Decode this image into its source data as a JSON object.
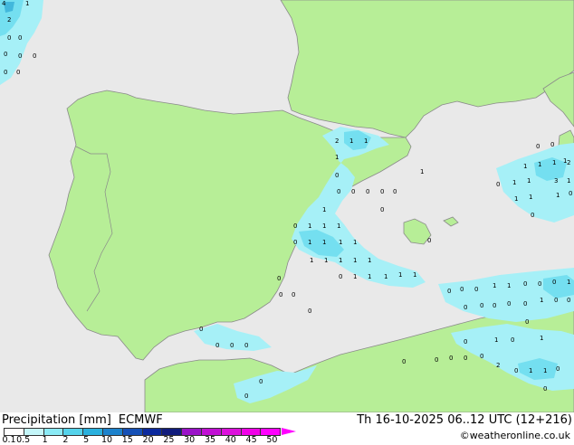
{
  "title": {
    "variable": "Precipitation [mm]",
    "model": "ECMWF",
    "valid_time": "Th 16-10-2025 06..12 UTC (12+216)"
  },
  "credit": "©weatheronline.co.uk",
  "colors": {
    "land": "#b7ee97",
    "sea": "#e9e9e9",
    "coast": "#8a8a8a",
    "precip_light": "#a6f0f7",
    "precip_medium": "#74dff0",
    "precip_heavy": "#42b8dc"
  },
  "legend": {
    "labels": [
      "0.1",
      "0.5",
      "1",
      "2",
      "5",
      "10",
      "15",
      "20",
      "25",
      "30",
      "35",
      "40",
      "45",
      "50"
    ],
    "colors": [
      "#ffffff",
      "#c4f6f9",
      "#8aeaf5",
      "#54d2ea",
      "#2ab0dd",
      "#1c82cc",
      "#1550b6",
      "#0c2a9e",
      "#111c7c",
      "#9a12c8",
      "#c10fd4",
      "#dc10dc",
      "#f000e8",
      "#ff00ff"
    ]
  },
  "precip_values": [
    "4",
    "1",
    "2",
    "0",
    "0",
    "0",
    "0",
    "0",
    "0",
    "0",
    "2",
    "1",
    "1",
    "1",
    "0",
    "0",
    "0",
    "0",
    "0",
    "0",
    "1",
    "0",
    "1",
    "1",
    "0",
    "1",
    "1",
    "1",
    "0",
    "1",
    "1",
    "1",
    "1",
    "1",
    "1",
    "1",
    "1",
    "1",
    "0",
    "1",
    "1",
    "1",
    "1",
    "0",
    "0",
    "0",
    "0",
    "0",
    "0",
    "0",
    "0",
    "0",
    "0",
    "0",
    "0",
    "0",
    "1",
    "1",
    "1",
    "1",
    "2",
    "0",
    "1",
    "1",
    "3",
    "1",
    "1",
    "1",
    "1",
    "0",
    "0",
    "0",
    "0",
    "0",
    "1",
    "1",
    "0",
    "0",
    "0",
    "0",
    "0",
    "0",
    "0",
    "0",
    "1",
    "1",
    "0",
    "0",
    "0",
    "0",
    "1",
    "0",
    "1",
    "0",
    "0",
    "0",
    "0",
    "0",
    "2",
    "1",
    "1",
    "0",
    "0",
    "0"
  ]
}
